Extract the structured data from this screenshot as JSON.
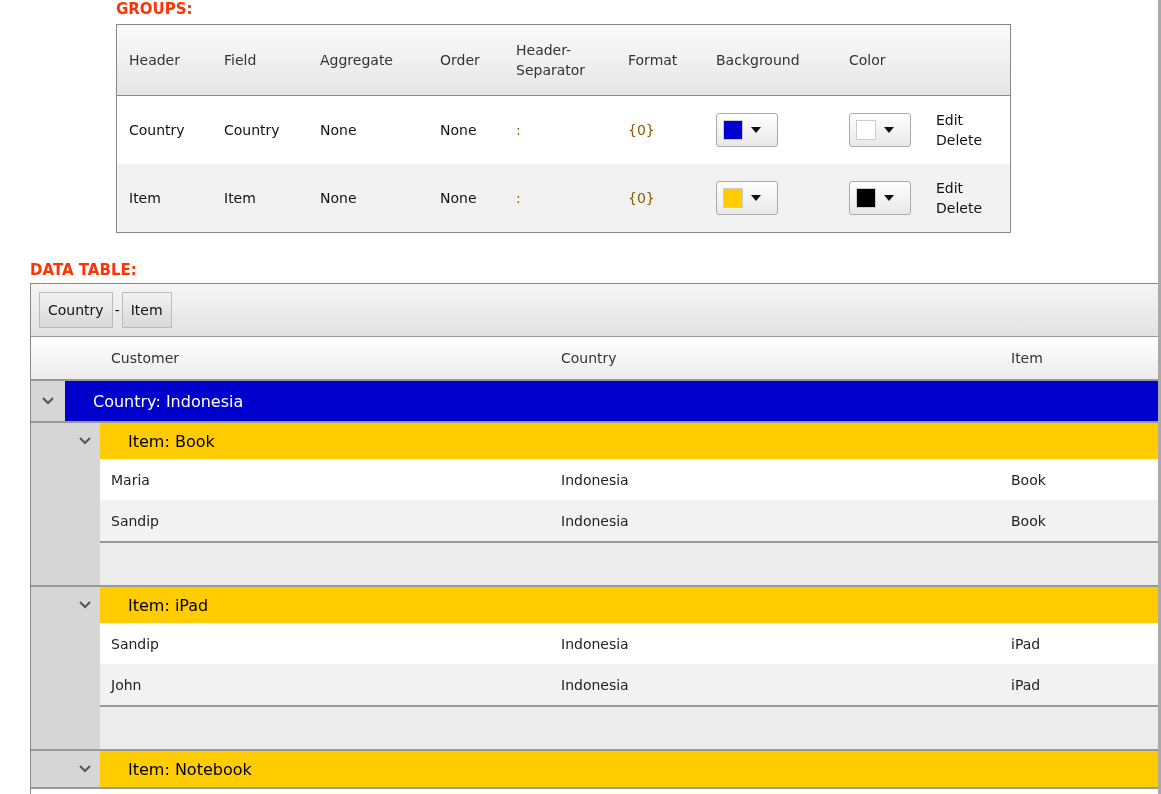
{
  "groups_editor": {
    "title": "GROUPS:",
    "columns": [
      "Header",
      "Field",
      "Aggregate",
      "Order",
      "Header-\nSeparator",
      "Format",
      "Background",
      "Color"
    ],
    "rows": [
      {
        "header": "Country",
        "field": "Country",
        "aggregate": "None",
        "order": "None",
        "separator": ":",
        "format": "{0}",
        "background": {
          "color": "#0000cc"
        },
        "foreground": {
          "color": "#ffffff"
        },
        "actions": [
          "Edit",
          "Delete"
        ]
      },
      {
        "header": "Item",
        "field": "Item",
        "aggregate": "None",
        "order": "None",
        "separator": ":",
        "format": "{0}",
        "background": {
          "color": "#ffcc00"
        },
        "foreground": {
          "color": "#000000"
        },
        "actions": [
          "Edit",
          "Delete"
        ]
      }
    ]
  },
  "data_table": {
    "title": "DATA TABLE:",
    "group_chips": [
      "Country",
      "Item"
    ],
    "chip_separator": "-",
    "columns": [
      "Customer",
      "Country",
      "Item"
    ],
    "groups": [
      {
        "label": "Country: Indonesia",
        "expanded": true,
        "children": [
          {
            "label": "Item: Book",
            "expanded": true,
            "rows": [
              [
                "Maria",
                "Indonesia",
                "Book"
              ],
              [
                "Sandip",
                "Indonesia",
                "Book"
              ]
            ]
          },
          {
            "label": "Item: iPad",
            "expanded": true,
            "rows": [
              [
                "Sandip",
                "Indonesia",
                "iPad"
              ],
              [
                "John",
                "Indonesia",
                "iPad"
              ]
            ]
          },
          {
            "label": "Item: Notebook",
            "expanded": true
          }
        ]
      }
    ]
  }
}
